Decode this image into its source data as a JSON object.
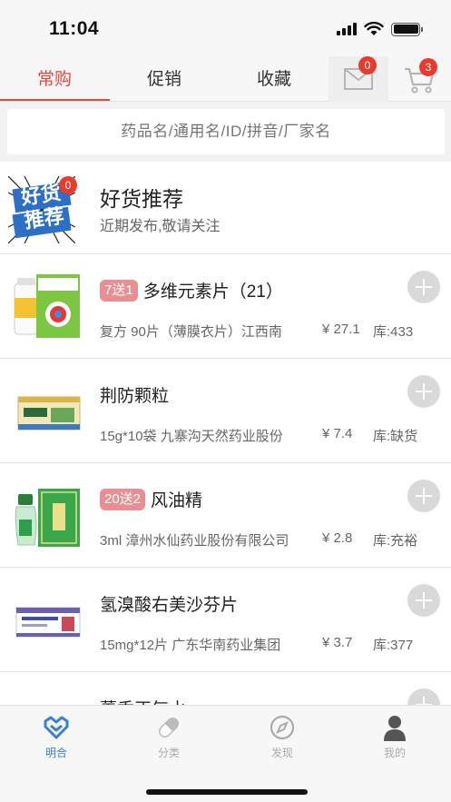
{
  "status_bar": {
    "time": "11:04"
  },
  "top_tabs": [
    {
      "label": "常购",
      "active": true
    },
    {
      "label": "促销",
      "active": false
    },
    {
      "label": "收藏",
      "active": false
    }
  ],
  "messages": {
    "count": "0",
    "icon": "mail-icon"
  },
  "cart": {
    "count": "3",
    "icon": "cart-icon"
  },
  "search": {
    "placeholder": "药品名/通用名/ID/拼音/厂家名"
  },
  "recommend": {
    "logo_text_top": "好货",
    "logo_text_bottom": "推荐",
    "badge": "0",
    "title": "好货推荐",
    "subtitle": "近期发布,敬请关注"
  },
  "products": [
    {
      "promo": "7送1",
      "name": "多维元素片（21）",
      "spec": "复方 90片（薄膜衣片）江西南",
      "price": "¥ 27.1",
      "stock": "库:433"
    },
    {
      "promo": "",
      "name": "荆防颗粒",
      "spec": "15g*10袋 九寨沟天然药业股份",
      "price": "¥ 7.4",
      "stock": "库:缺货"
    },
    {
      "promo": "20送2",
      "name": "风油精",
      "spec": "3ml 漳州水仙药业股份有限公司",
      "price": "¥ 2.8",
      "stock": "库:充裕"
    },
    {
      "promo": "",
      "name": "氢溴酸右美沙芬片",
      "spec": "15mg*12片 广东华南药业集团",
      "price": "¥ 3.7",
      "stock": "库:377"
    },
    {
      "promo": "",
      "name": "藿香正气水",
      "spec": "",
      "price": "",
      "stock": ""
    }
  ],
  "bottom_nav": [
    {
      "label": "明合",
      "icon": "heart-logo-icon",
      "active": true
    },
    {
      "label": "分类",
      "icon": "capsule-icon",
      "active": false
    },
    {
      "label": "发现",
      "icon": "compass-icon",
      "active": false
    },
    {
      "label": "我的",
      "icon": "person-icon",
      "active": false
    }
  ],
  "colors": {
    "accent": "#e44a3a",
    "promo": "#e88f93",
    "badge": "#e63b2e",
    "nav_active": "#3a7fd6"
  }
}
